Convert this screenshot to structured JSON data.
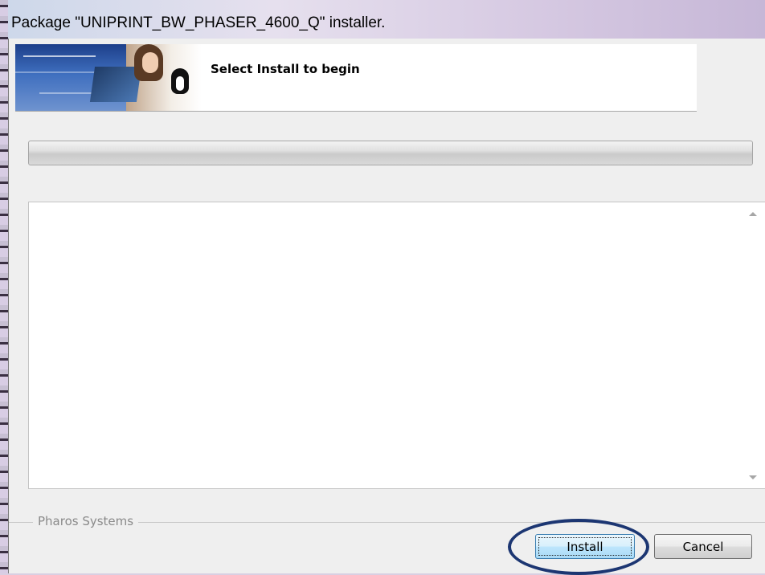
{
  "window": {
    "title": "Package \"UNIPRINT_BW_PHASER_4600_Q\" installer."
  },
  "header": {
    "message": "Select Install to begin",
    "banner_image": "installer-banner-person-laptop-penguin"
  },
  "progress": {
    "value": 0
  },
  "log": {
    "text": ""
  },
  "footer": {
    "group_label": "Pharos Systems",
    "install_label": "Install",
    "cancel_label": "Cancel"
  },
  "colors": {
    "annotation_ellipse": "#1c3672",
    "install_button_border": "#3c7fb1"
  }
}
